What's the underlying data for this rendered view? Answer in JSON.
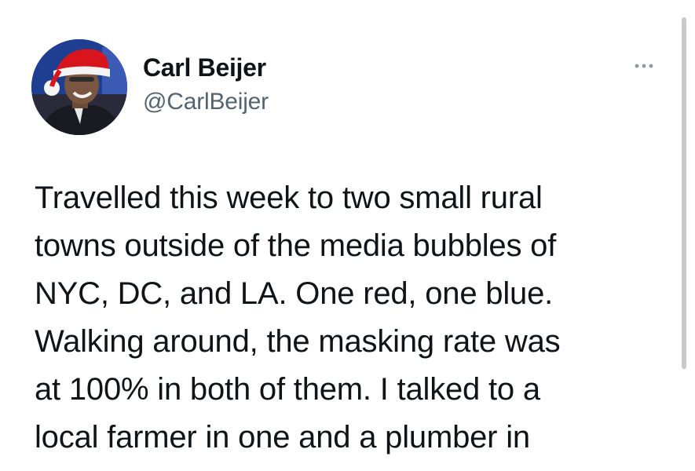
{
  "author": {
    "name": "Carl Beijer",
    "handle": "@CarlBeijer"
  },
  "menu": {
    "more_icon": "more-horizontal-icon"
  },
  "tweet": {
    "lines": [
      "Travelled this week to two small rural",
      "towns outside of the media bubbles of",
      "NYC, DC, and LA. One red, one blue.",
      "Walking around, the masking rate was",
      "at 100% in both of them. I talked to a",
      "local farmer in one and a plumber in"
    ]
  },
  "colors": {
    "text_primary": "#0f1419",
    "text_secondary": "#536471",
    "background": "#ffffff",
    "icon_gray": "#8b98a5"
  }
}
